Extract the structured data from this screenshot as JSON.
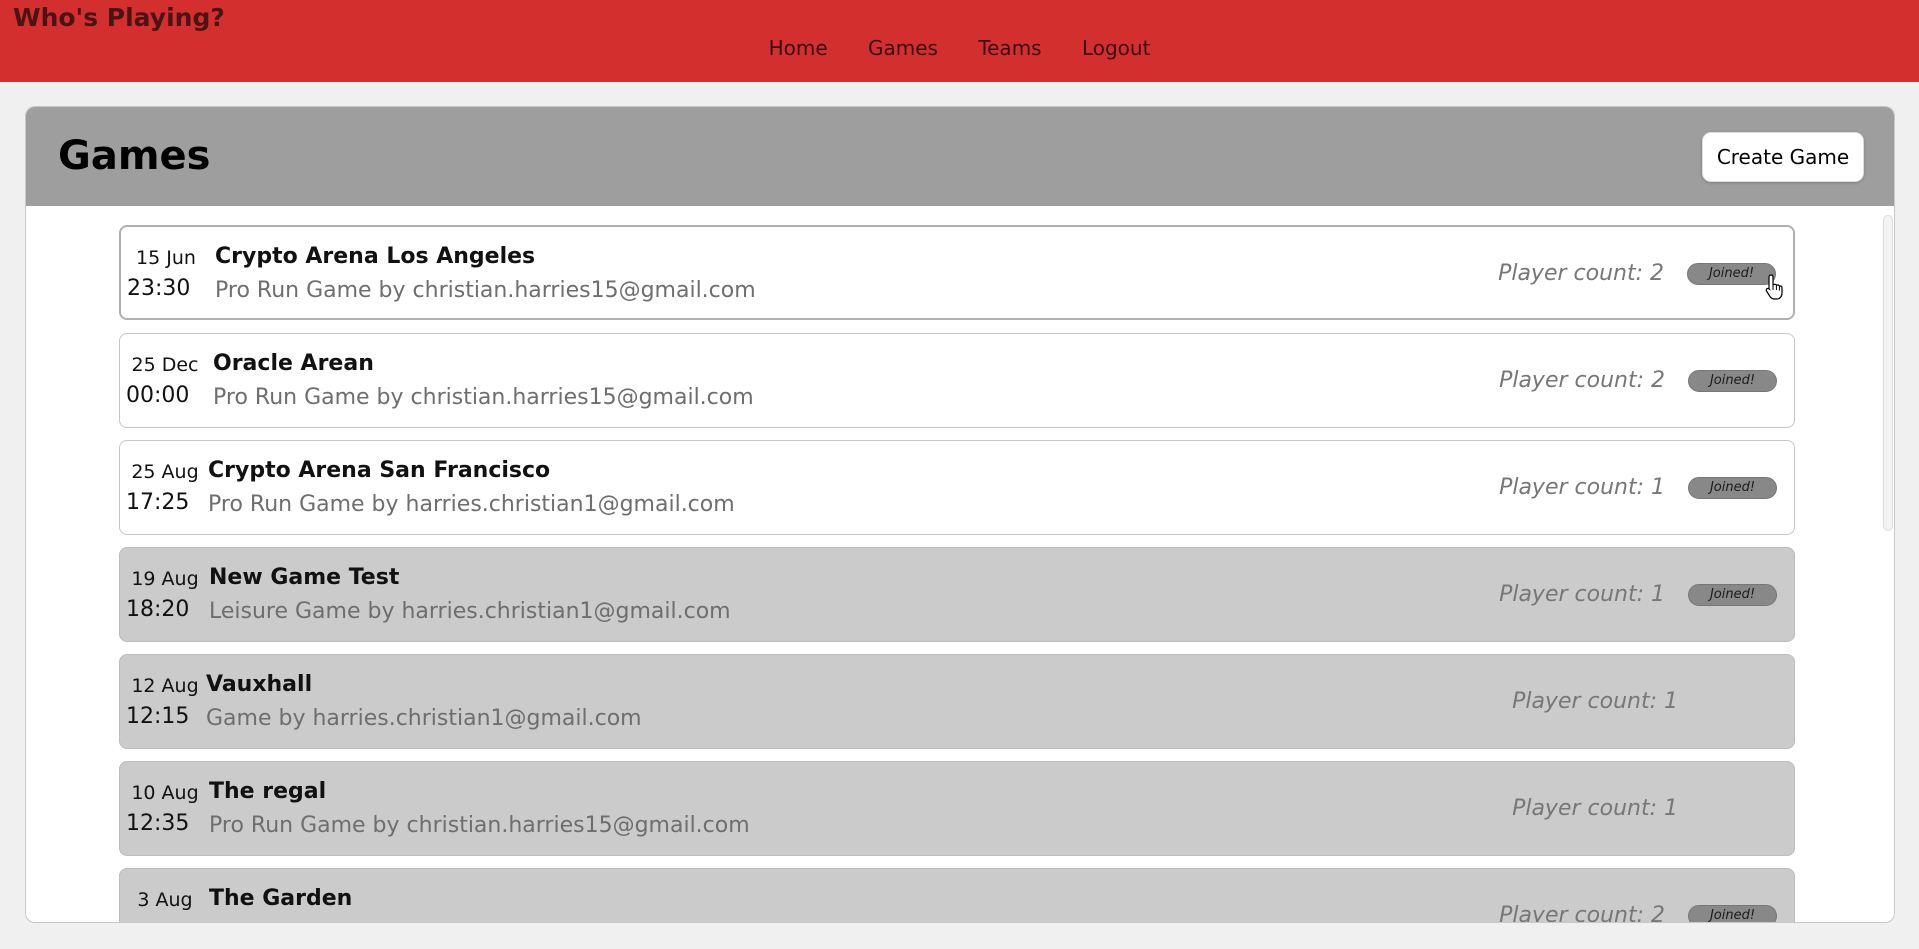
{
  "app": {
    "title": "Who's Playing?"
  },
  "nav": {
    "items": [
      "Home",
      "Games",
      "Teams",
      "Logout"
    ]
  },
  "page": {
    "title": "Games",
    "create_label": "Create Game"
  },
  "games": [
    {
      "date": "15 Jun",
      "time": "23:30",
      "name": "Crypto Arena Los Angeles",
      "desc": "Pro Run Game by christian.harries15@gmail.com",
      "count": "Player count: 2",
      "badge": "Joined!"
    },
    {
      "date": "25 Dec",
      "time": "00:00",
      "name": "Oracle Arean",
      "desc": "Pro Run Game by christian.harries15@gmail.com",
      "count": "Player count: 2",
      "badge": "Joined!"
    },
    {
      "date": "25 Aug",
      "time": "17:25",
      "name": "Crypto Arena San Francisco",
      "desc": "Pro Run Game by harries.christian1@gmail.com",
      "count": "Player count: 1",
      "badge": "Joined!"
    },
    {
      "date": "19 Aug",
      "time": "18:20",
      "name": "New Game Test",
      "desc": "Leisure Game by harries.christian1@gmail.com",
      "count": "Player count: 1",
      "badge": "Joined!"
    },
    {
      "date": "12 Aug",
      "time": "12:15",
      "name": "Vauxhall",
      "desc": "Game by harries.christian1@gmail.com",
      "count": "Player count: 1",
      "badge": ""
    },
    {
      "date": "10 Aug",
      "time": "12:35",
      "name": "The regal",
      "desc": "Pro Run Game by christian.harries15@gmail.com",
      "count": "Player count: 1",
      "badge": ""
    },
    {
      "date": "3 Aug",
      "time": "",
      "name": "The Garden",
      "desc": "",
      "count": "Player count: 2",
      "badge": "Joined!"
    }
  ]
}
